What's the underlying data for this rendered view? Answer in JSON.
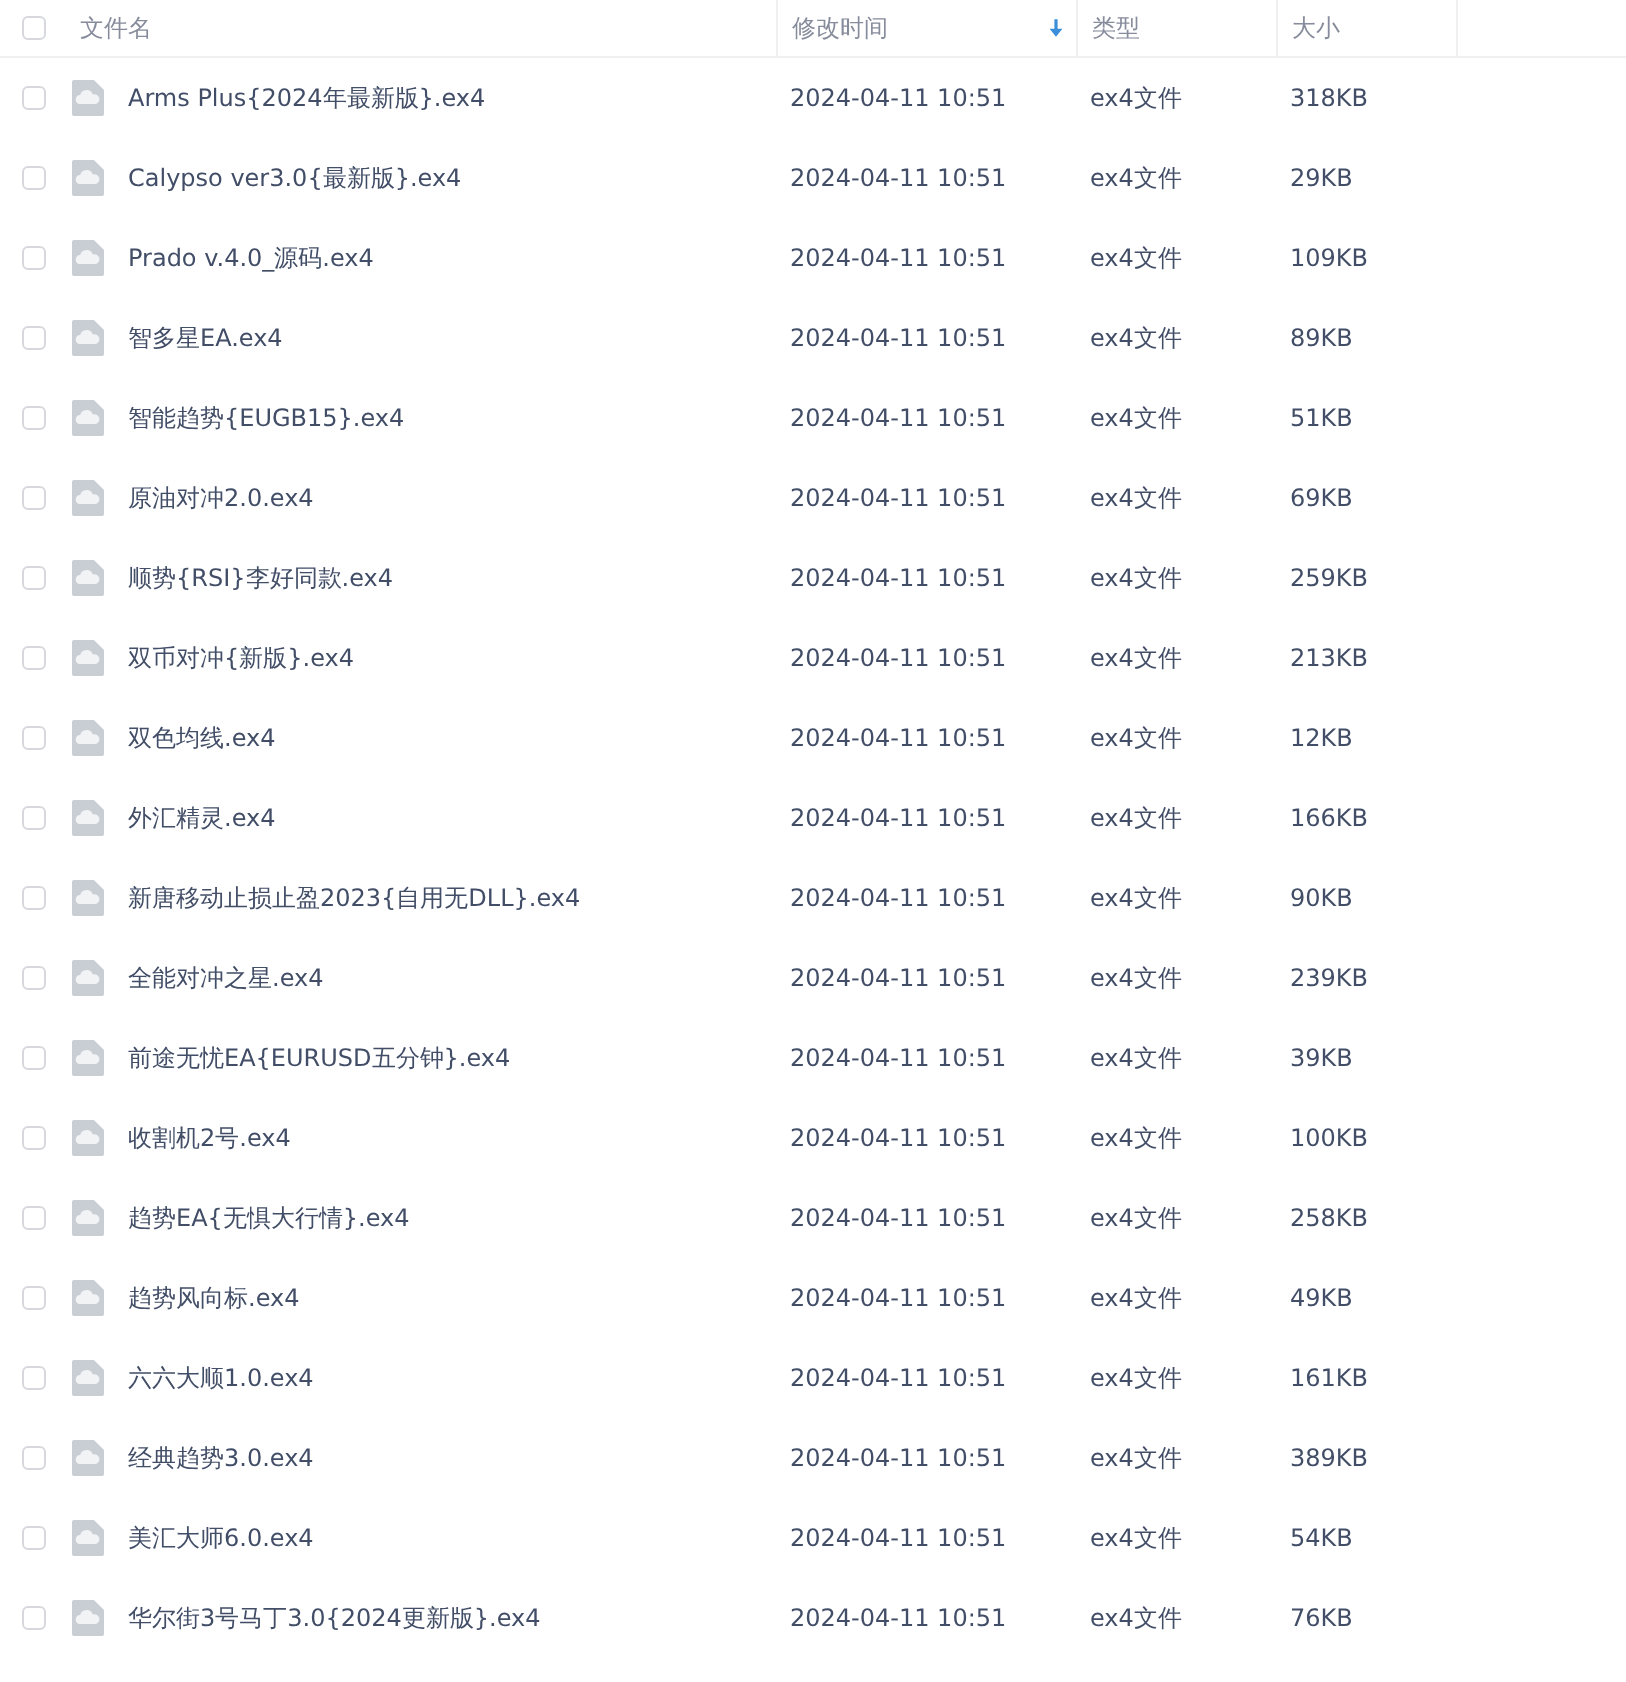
{
  "table": {
    "select_all": {
      "checked": false
    },
    "columns": [
      {
        "label": "文件名",
        "sorted": false
      },
      {
        "label": "修改时间",
        "sorted": true
      },
      {
        "label": "类型",
        "sorted": false
      },
      {
        "label": "大小",
        "sorted": false
      }
    ],
    "rows": [
      {
        "checked": false,
        "name": "Arms Plus{2024年最新版}.ex4",
        "modified": "2024-04-11 10:51",
        "type": "ex4文件",
        "size": "318KB"
      },
      {
        "checked": false,
        "name": "Calypso ver3.0{最新版}.ex4",
        "modified": "2024-04-11 10:51",
        "type": "ex4文件",
        "size": "29KB"
      },
      {
        "checked": false,
        "name": "Prado v.4.0_源码.ex4",
        "modified": "2024-04-11 10:51",
        "type": "ex4文件",
        "size": "109KB"
      },
      {
        "checked": false,
        "name": "智多星EA.ex4",
        "modified": "2024-04-11 10:51",
        "type": "ex4文件",
        "size": "89KB"
      },
      {
        "checked": false,
        "name": "智能趋势{EUGB15}.ex4",
        "modified": "2024-04-11 10:51",
        "type": "ex4文件",
        "size": "51KB"
      },
      {
        "checked": false,
        "name": "原油对冲2.0.ex4",
        "modified": "2024-04-11 10:51",
        "type": "ex4文件",
        "size": "69KB"
      },
      {
        "checked": false,
        "name": "顺势{RSI}李好同款.ex4",
        "modified": "2024-04-11 10:51",
        "type": "ex4文件",
        "size": "259KB"
      },
      {
        "checked": false,
        "name": "双币对冲{新版}.ex4",
        "modified": "2024-04-11 10:51",
        "type": "ex4文件",
        "size": "213KB"
      },
      {
        "checked": false,
        "name": "双色均线.ex4",
        "modified": "2024-04-11 10:51",
        "type": "ex4文件",
        "size": "12KB"
      },
      {
        "checked": false,
        "name": "外汇精灵.ex4",
        "modified": "2024-04-11 10:51",
        "type": "ex4文件",
        "size": "166KB"
      },
      {
        "checked": false,
        "name": "新唐移动止损止盈2023{自用无DLL}.ex4",
        "modified": "2024-04-11 10:51",
        "type": "ex4文件",
        "size": "90KB"
      },
      {
        "checked": false,
        "name": "全能对冲之星.ex4",
        "modified": "2024-04-11 10:51",
        "type": "ex4文件",
        "size": "239KB"
      },
      {
        "checked": false,
        "name": "前途无忧EA{EURUSD五分钟}.ex4",
        "modified": "2024-04-11 10:51",
        "type": "ex4文件",
        "size": "39KB"
      },
      {
        "checked": false,
        "name": "收割机2号.ex4",
        "modified": "2024-04-11 10:51",
        "type": "ex4文件",
        "size": "100KB"
      },
      {
        "checked": false,
        "name": "趋势EA{无惧大行情}.ex4",
        "modified": "2024-04-11 10:51",
        "type": "ex4文件",
        "size": "258KB"
      },
      {
        "checked": false,
        "name": "趋势风向标.ex4",
        "modified": "2024-04-11 10:51",
        "type": "ex4文件",
        "size": "49KB"
      },
      {
        "checked": false,
        "name": "六六大顺1.0.ex4",
        "modified": "2024-04-11 10:51",
        "type": "ex4文件",
        "size": "161KB"
      },
      {
        "checked": false,
        "name": "经典趋势3.0.ex4",
        "modified": "2024-04-11 10:51",
        "type": "ex4文件",
        "size": "389KB"
      },
      {
        "checked": false,
        "name": "美汇大师6.0.ex4",
        "modified": "2024-04-11 10:51",
        "type": "ex4文件",
        "size": "54KB"
      },
      {
        "checked": false,
        "name": "华尔街3号马丁3.0{2024更新版}.ex4",
        "modified": "2024-04-11 10:51",
        "type": "ex4文件",
        "size": "76KB"
      }
    ]
  }
}
